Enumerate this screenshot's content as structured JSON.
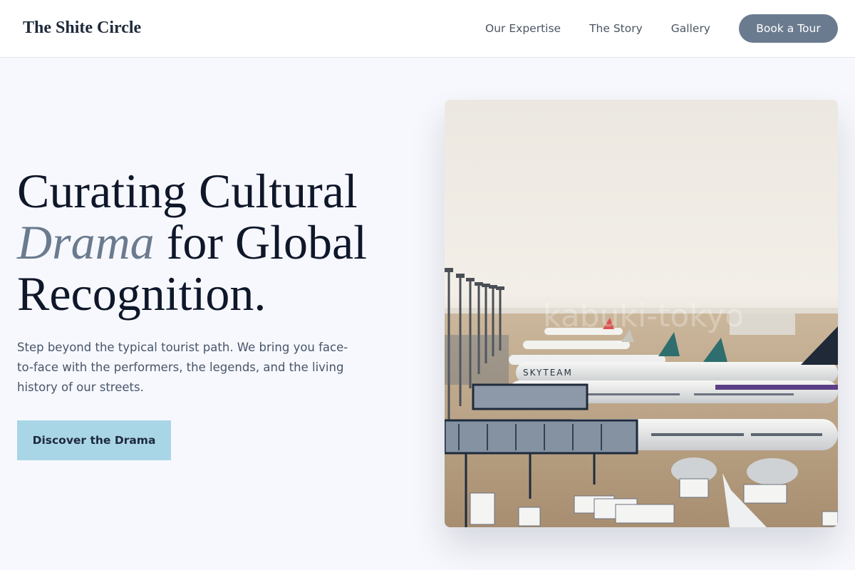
{
  "header": {
    "logo": "The Shite Circle",
    "nav": [
      {
        "label": "Our Expertise"
      },
      {
        "label": "The Story"
      },
      {
        "label": "Gallery"
      }
    ],
    "cta_label": "Book a Tour"
  },
  "hero": {
    "headline_line1": "Curating Cultural",
    "headline_emphasis": "Drama",
    "headline_line2_rest": " for Global",
    "headline_line3": "Recognition.",
    "subtext": "Step beyond the typical tourist path. We bring you face-to-face with the performers, the legends, and the living history of our streets.",
    "cta_label": "Discover the Drama",
    "image": {
      "plane_livery_text": "SKYTEAM",
      "watermark_text": "kabuki-tokyo"
    }
  },
  "colors": {
    "accent": "#6b7b8f",
    "cta_bg": "#a9d6e6",
    "page_bg": "#f7f8fd"
  }
}
